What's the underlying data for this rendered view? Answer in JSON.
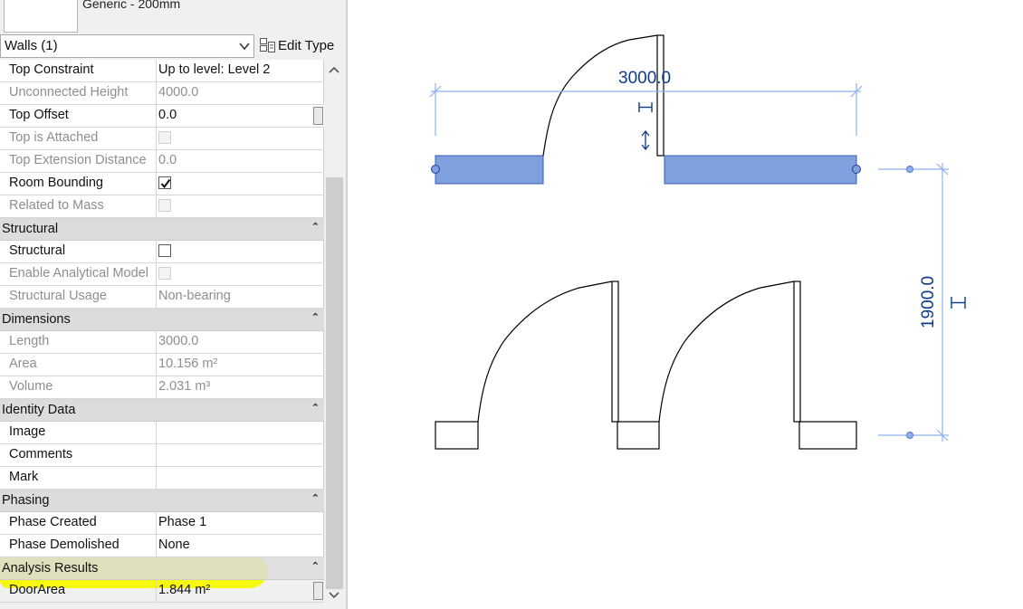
{
  "type_selector": {
    "type_name": "Generic - 200mm"
  },
  "instance_filter": {
    "selected": "Walls (1)"
  },
  "edit_type_label": "Edit Type",
  "groups": {
    "constraints": [
      {
        "label": "Top Constraint",
        "value": "Up to level: Level 2"
      },
      {
        "label": "Unconnected Height",
        "value": "4000.0"
      },
      {
        "label": "Top Offset",
        "value": "0.0"
      },
      {
        "label": "Top is Attached",
        "value": ""
      },
      {
        "label": "Top Extension Distance",
        "value": "0.0"
      },
      {
        "label": "Room Bounding",
        "value": ""
      },
      {
        "label": "Related to Mass",
        "value": ""
      }
    ],
    "structural": {
      "title": "Structural",
      "rows": [
        {
          "label": "Structural",
          "value": ""
        },
        {
          "label": "Enable Analytical Model",
          "value": ""
        },
        {
          "label": "Structural Usage",
          "value": "Non-bearing"
        }
      ]
    },
    "dimensions": {
      "title": "Dimensions",
      "rows": [
        {
          "label": "Length",
          "value": "3000.0"
        },
        {
          "label": "Area",
          "value": "10.156 m²"
        },
        {
          "label": "Volume",
          "value": "2.031 m³"
        }
      ]
    },
    "identity": {
      "title": "Identity Data",
      "rows": [
        {
          "label": "Image",
          "value": ""
        },
        {
          "label": "Comments",
          "value": ""
        },
        {
          "label": "Mark",
          "value": ""
        }
      ]
    },
    "phasing": {
      "title": "Phasing",
      "rows": [
        {
          "label": "Phase Created",
          "value": "Phase 1"
        },
        {
          "label": "Phase Demolished",
          "value": "None"
        }
      ]
    },
    "analysis": {
      "title": "Analysis Results",
      "rows": [
        {
          "label": "DoorArea",
          "value": "1.844 m²"
        }
      ]
    }
  },
  "checkboxes": {
    "top_is_attached": false,
    "room_bounding": true,
    "related_to_mass": false,
    "structural": false,
    "enable_analytical_model": false
  },
  "drawing": {
    "horizontal_dimension": "3000.0",
    "vertical_dimension": "1900.0",
    "selected_wall_color": "#7f9fde",
    "dimension_color": "#0b3a8c",
    "highlight_color": "#f7f702"
  }
}
